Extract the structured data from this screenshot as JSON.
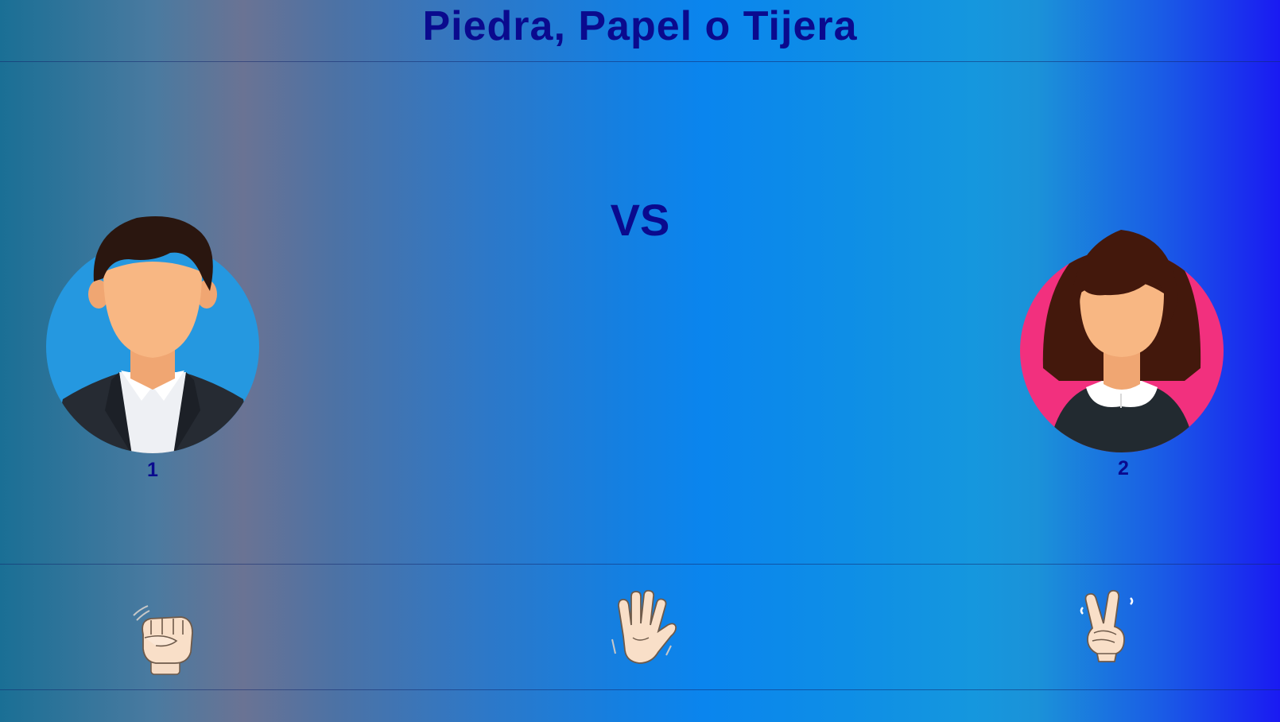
{
  "header": {
    "title": "Piedra, Papel o Tijera"
  },
  "arena": {
    "vs_label": "VS",
    "player1": {
      "label": "1",
      "avatar_icon": "man-avatar-icon",
      "bg_color": "#2598e0"
    },
    "player2": {
      "label": "2",
      "avatar_icon": "woman-avatar-icon",
      "bg_color": "#f2307e"
    }
  },
  "choices": [
    {
      "name": "rock",
      "icon": "fist-icon"
    },
    {
      "name": "paper",
      "icon": "open-hand-icon"
    },
    {
      "name": "scissors",
      "icon": "peace-hand-icon"
    }
  ],
  "colors": {
    "text": "#0a0a8e"
  }
}
